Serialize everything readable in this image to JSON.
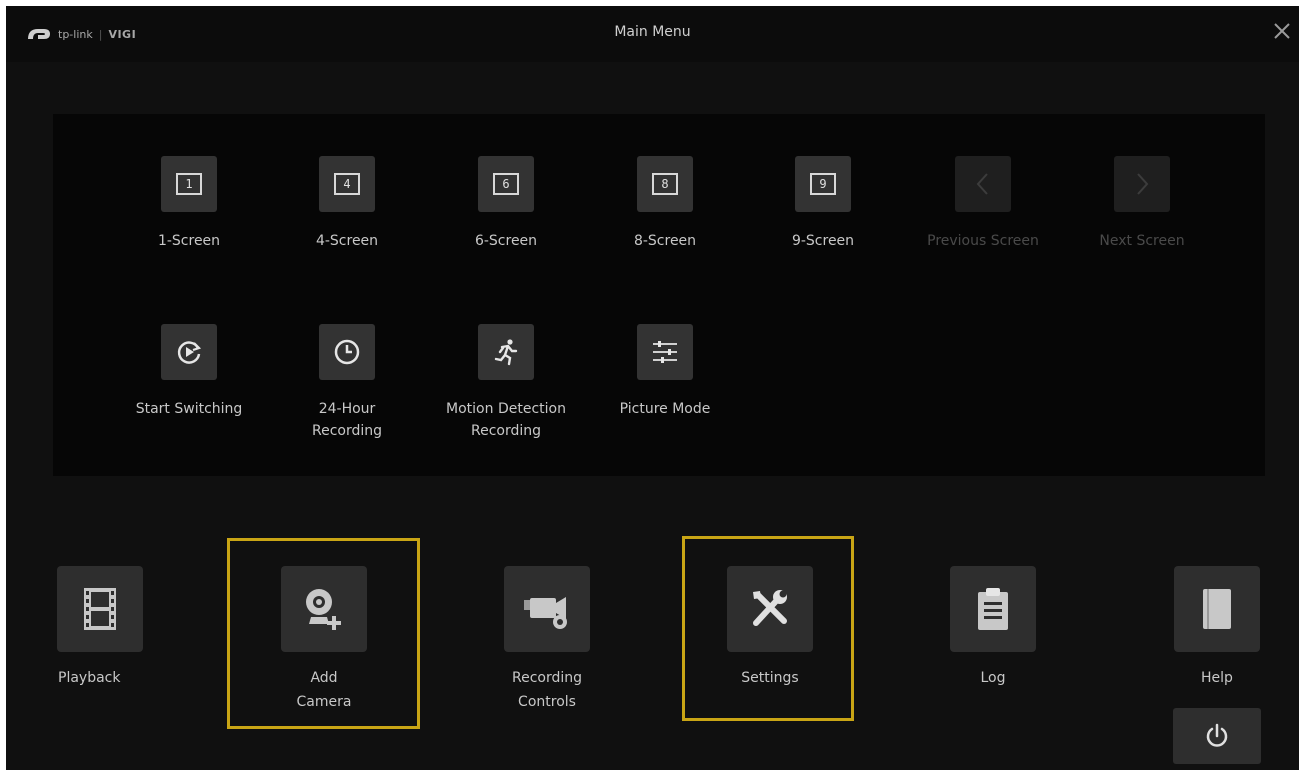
{
  "header": {
    "brand": "tp-link",
    "sub_brand": "VIGI",
    "title": "Main Menu",
    "close_icon": "close-icon"
  },
  "screen_modes": [
    {
      "label": "1-Screen",
      "number": "1",
      "enabled": true
    },
    {
      "label": "4-Screen",
      "number": "4",
      "enabled": true
    },
    {
      "label": "6-Screen",
      "number": "6",
      "enabled": true
    },
    {
      "label": "8-Screen",
      "number": "8",
      "enabled": true
    },
    {
      "label": "9-Screen",
      "number": "9",
      "enabled": true
    },
    {
      "label": "Previous Screen",
      "icon": "chevron-left-icon",
      "enabled": false
    },
    {
      "label": "Next Screen",
      "icon": "chevron-right-icon",
      "enabled": false
    }
  ],
  "quick_actions": [
    {
      "label": "Start Switching",
      "icon": "rotate-play-icon"
    },
    {
      "label_line1": "24-Hour",
      "label_line2": "Recording",
      "icon": "clock-icon"
    },
    {
      "label_line1": "Motion Detection",
      "label_line2": "Recording",
      "icon": "running-man-icon"
    },
    {
      "label": "Picture Mode",
      "icon": "sliders-icon"
    }
  ],
  "main_items": [
    {
      "label": "Playback",
      "icon": "film-icon"
    },
    {
      "label_line1": "Add",
      "label_line2": "Camera",
      "icon": "add-camera-icon",
      "highlighted": true
    },
    {
      "label_line1": "Recording",
      "label_line2": "Controls",
      "icon": "video-camera-gear-icon"
    },
    {
      "label": "Settings",
      "icon": "tools-icon",
      "highlighted": true
    },
    {
      "label": "Log",
      "icon": "clipboard-icon"
    },
    {
      "label": "Help",
      "icon": "book-icon"
    }
  ],
  "power": {
    "icon": "power-icon"
  },
  "colors": {
    "background": "#101010",
    "panel": "#060606",
    "icon_box": "#333333",
    "highlight": "#c9a515",
    "text": "#c8c8c8"
  }
}
